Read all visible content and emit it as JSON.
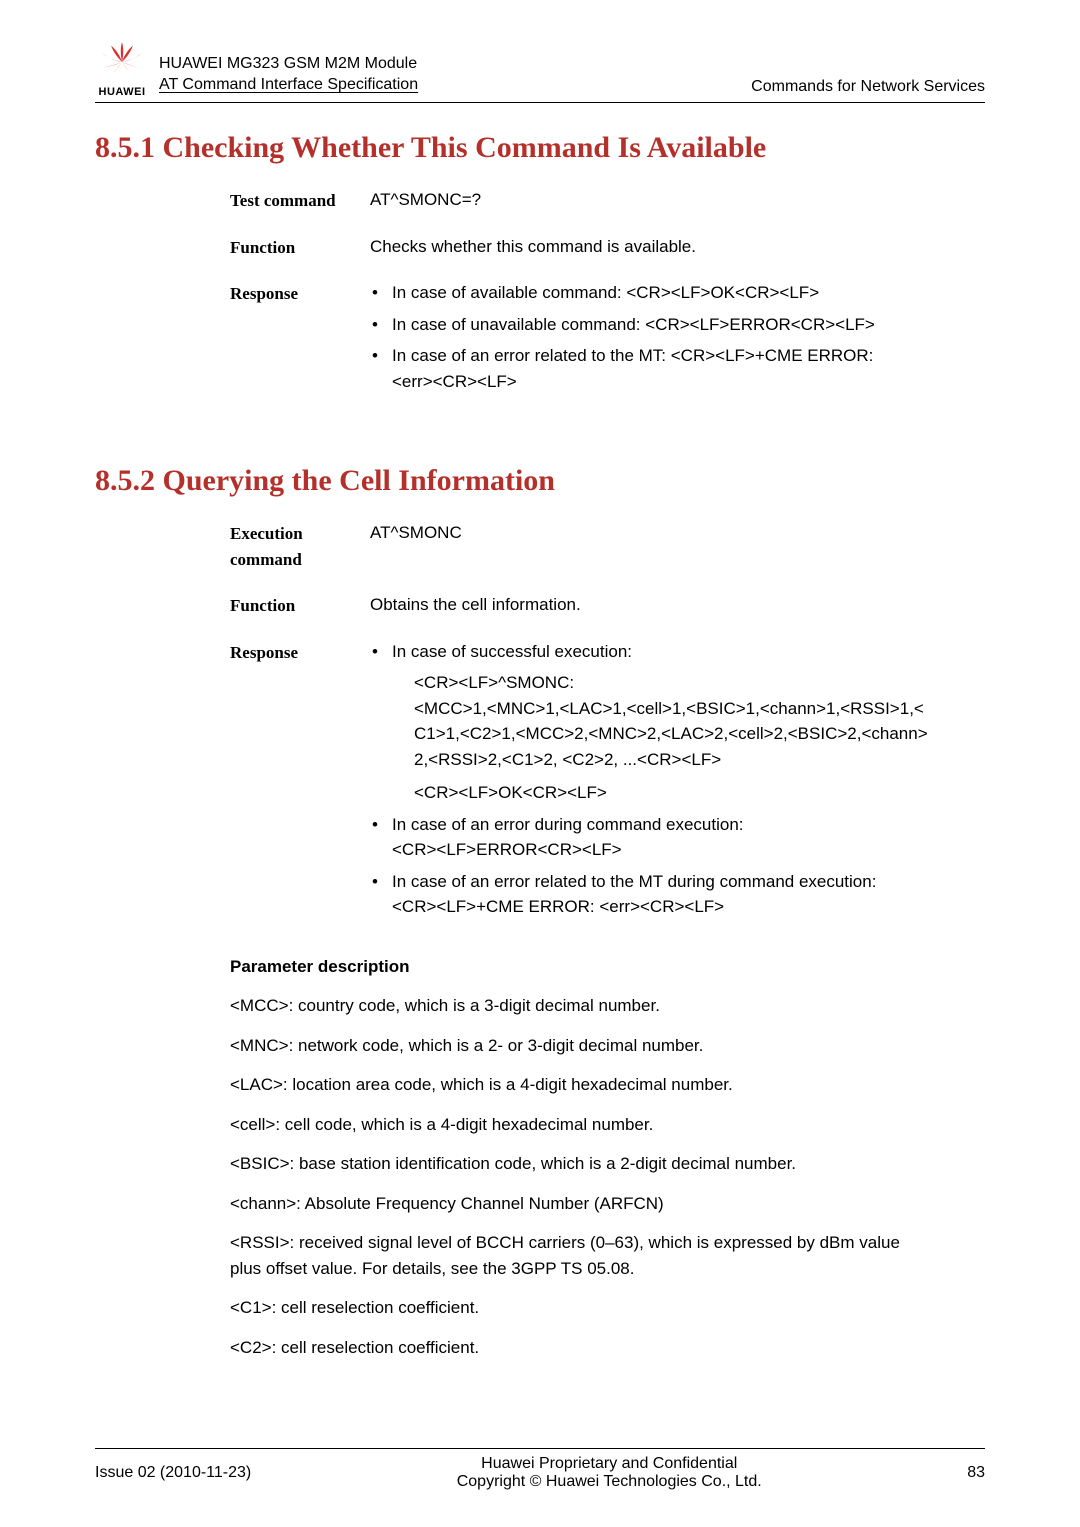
{
  "header": {
    "line1": "HUAWEI MG323 GSM M2M Module",
    "line2": "AT Command Interface Specification",
    "right": "Commands for Network Services",
    "logo_text": "HUAWEI"
  },
  "section1": {
    "title": "8.5.1 Checking Whether This Command Is Available",
    "rows": {
      "test_label": "Test command",
      "test_value": "AT^SMONC=?",
      "func_label": "Function",
      "func_value": "Checks whether this command is available.",
      "resp_label": "Response",
      "resp_b1": "In case of available command: <CR><LF>OK<CR><LF>",
      "resp_b2": "In case of unavailable command: <CR><LF>ERROR<CR><LF>",
      "resp_b3a": "In case of an error related to the MT: <CR><LF>+CME ERROR:",
      "resp_b3b": "<err><CR><LF>"
    }
  },
  "section2": {
    "title": "8.5.2 Querying the Cell Information",
    "rows": {
      "exec_label": "Execution command",
      "exec_value": "AT^SMONC",
      "func_label": "Function",
      "func_value": "Obtains the cell information.",
      "resp_label": "Response",
      "b1_l1": "In case of successful execution:",
      "b1_l2": "<CR><LF>^SMONC:",
      "b1_l3": "<MCC>1,<MNC>1,<LAC>1,<cell>1,<BSIC>1,<chann>1,<RSSI>1,<",
      "b1_l4": "C1>1,<C2>1,<MCC>2,<MNC>2,<LAC>2,<cell>2,<BSIC>2,<chann>",
      "b1_l5": "2,<RSSI>2,<C1>2, <C2>2, ...<CR><LF>",
      "b1_l6": "<CR><LF>OK<CR><LF>",
      "b2_l1": "In case of an error during command execution:",
      "b2_l2": "<CR><LF>ERROR<CR><LF>",
      "b3_l1": "In case of an error related to the MT during command execution:",
      "b3_l2": "<CR><LF>+CME ERROR: <err><CR><LF>"
    }
  },
  "params": {
    "heading": "Parameter description",
    "p1": "<MCC>: country code, which is a 3-digit decimal number.",
    "p2": "<MNC>: network code, which is a 2- or 3-digit decimal number.",
    "p3": "<LAC>: location area code, which is a 4-digit hexadecimal number.",
    "p4": "<cell>: cell code, which is a 4-digit hexadecimal number.",
    "p5": "<BSIC>: base station identification code, which is a 2-digit decimal number.",
    "p6": "<chann>: Absolute Frequency Channel Number (ARFCN)",
    "p7": "<RSSI>: received signal level of BCCH carriers (0–63), which is expressed by dBm value plus offset value. For details, see the 3GPP TS 05.08.",
    "p8": "<C1>: cell reselection coefficient.",
    "p9": "<C2>: cell reselection coefficient."
  },
  "footer": {
    "left": "Issue 02 (2010-11-23)",
    "center1": "Huawei Proprietary and Confidential",
    "center2": "Copyright © Huawei Technologies Co., Ltd.",
    "right": "83"
  }
}
